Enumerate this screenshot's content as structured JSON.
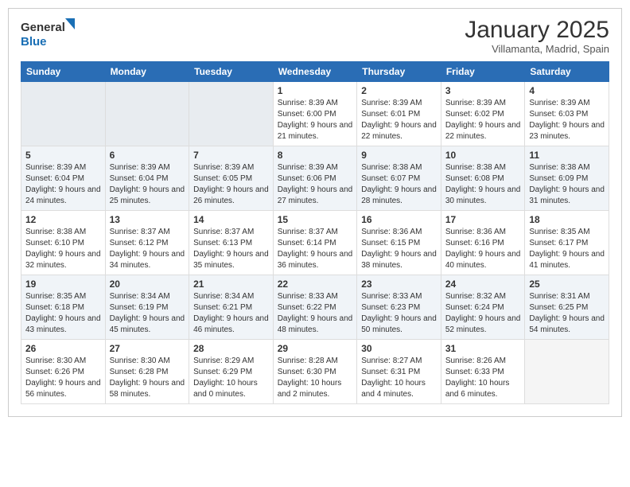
{
  "header": {
    "logo_line1": "General",
    "logo_line2": "Blue",
    "month": "January 2025",
    "location": "Villamanta, Madrid, Spain"
  },
  "days_of_week": [
    "Sunday",
    "Monday",
    "Tuesday",
    "Wednesday",
    "Thursday",
    "Friday",
    "Saturday"
  ],
  "weeks": [
    [
      {
        "day": "",
        "sunrise": "",
        "sunset": "",
        "daylight": ""
      },
      {
        "day": "",
        "sunrise": "",
        "sunset": "",
        "daylight": ""
      },
      {
        "day": "",
        "sunrise": "",
        "sunset": "",
        "daylight": ""
      },
      {
        "day": "1",
        "sunrise": "8:39 AM",
        "sunset": "6:00 PM",
        "daylight": "9 hours and 21 minutes."
      },
      {
        "day": "2",
        "sunrise": "8:39 AM",
        "sunset": "6:01 PM",
        "daylight": "9 hours and 22 minutes."
      },
      {
        "day": "3",
        "sunrise": "8:39 AM",
        "sunset": "6:02 PM",
        "daylight": "9 hours and 22 minutes."
      },
      {
        "day": "4",
        "sunrise": "8:39 AM",
        "sunset": "6:03 PM",
        "daylight": "9 hours and 23 minutes."
      }
    ],
    [
      {
        "day": "5",
        "sunrise": "8:39 AM",
        "sunset": "6:04 PM",
        "daylight": "9 hours and 24 minutes."
      },
      {
        "day": "6",
        "sunrise": "8:39 AM",
        "sunset": "6:04 PM",
        "daylight": "9 hours and 25 minutes."
      },
      {
        "day": "7",
        "sunrise": "8:39 AM",
        "sunset": "6:05 PM",
        "daylight": "9 hours and 26 minutes."
      },
      {
        "day": "8",
        "sunrise": "8:39 AM",
        "sunset": "6:06 PM",
        "daylight": "9 hours and 27 minutes."
      },
      {
        "day": "9",
        "sunrise": "8:38 AM",
        "sunset": "6:07 PM",
        "daylight": "9 hours and 28 minutes."
      },
      {
        "day": "10",
        "sunrise": "8:38 AM",
        "sunset": "6:08 PM",
        "daylight": "9 hours and 30 minutes."
      },
      {
        "day": "11",
        "sunrise": "8:38 AM",
        "sunset": "6:09 PM",
        "daylight": "9 hours and 31 minutes."
      }
    ],
    [
      {
        "day": "12",
        "sunrise": "8:38 AM",
        "sunset": "6:10 PM",
        "daylight": "9 hours and 32 minutes."
      },
      {
        "day": "13",
        "sunrise": "8:37 AM",
        "sunset": "6:12 PM",
        "daylight": "9 hours and 34 minutes."
      },
      {
        "day": "14",
        "sunrise": "8:37 AM",
        "sunset": "6:13 PM",
        "daylight": "9 hours and 35 minutes."
      },
      {
        "day": "15",
        "sunrise": "8:37 AM",
        "sunset": "6:14 PM",
        "daylight": "9 hours and 36 minutes."
      },
      {
        "day": "16",
        "sunrise": "8:36 AM",
        "sunset": "6:15 PM",
        "daylight": "9 hours and 38 minutes."
      },
      {
        "day": "17",
        "sunrise": "8:36 AM",
        "sunset": "6:16 PM",
        "daylight": "9 hours and 40 minutes."
      },
      {
        "day": "18",
        "sunrise": "8:35 AM",
        "sunset": "6:17 PM",
        "daylight": "9 hours and 41 minutes."
      }
    ],
    [
      {
        "day": "19",
        "sunrise": "8:35 AM",
        "sunset": "6:18 PM",
        "daylight": "9 hours and 43 minutes."
      },
      {
        "day": "20",
        "sunrise": "8:34 AM",
        "sunset": "6:19 PM",
        "daylight": "9 hours and 45 minutes."
      },
      {
        "day": "21",
        "sunrise": "8:34 AM",
        "sunset": "6:21 PM",
        "daylight": "9 hours and 46 minutes."
      },
      {
        "day": "22",
        "sunrise": "8:33 AM",
        "sunset": "6:22 PM",
        "daylight": "9 hours and 48 minutes."
      },
      {
        "day": "23",
        "sunrise": "8:33 AM",
        "sunset": "6:23 PM",
        "daylight": "9 hours and 50 minutes."
      },
      {
        "day": "24",
        "sunrise": "8:32 AM",
        "sunset": "6:24 PM",
        "daylight": "9 hours and 52 minutes."
      },
      {
        "day": "25",
        "sunrise": "8:31 AM",
        "sunset": "6:25 PM",
        "daylight": "9 hours and 54 minutes."
      }
    ],
    [
      {
        "day": "26",
        "sunrise": "8:30 AM",
        "sunset": "6:26 PM",
        "daylight": "9 hours and 56 minutes."
      },
      {
        "day": "27",
        "sunrise": "8:30 AM",
        "sunset": "6:28 PM",
        "daylight": "9 hours and 58 minutes."
      },
      {
        "day": "28",
        "sunrise": "8:29 AM",
        "sunset": "6:29 PM",
        "daylight": "10 hours and 0 minutes."
      },
      {
        "day": "29",
        "sunrise": "8:28 AM",
        "sunset": "6:30 PM",
        "daylight": "10 hours and 2 minutes."
      },
      {
        "day": "30",
        "sunrise": "8:27 AM",
        "sunset": "6:31 PM",
        "daylight": "10 hours and 4 minutes."
      },
      {
        "day": "31",
        "sunrise": "8:26 AM",
        "sunset": "6:33 PM",
        "daylight": "10 hours and 6 minutes."
      },
      {
        "day": "",
        "sunrise": "",
        "sunset": "",
        "daylight": ""
      }
    ]
  ],
  "labels": {
    "sunrise": "Sunrise:",
    "sunset": "Sunset:",
    "daylight": "Daylight:"
  }
}
